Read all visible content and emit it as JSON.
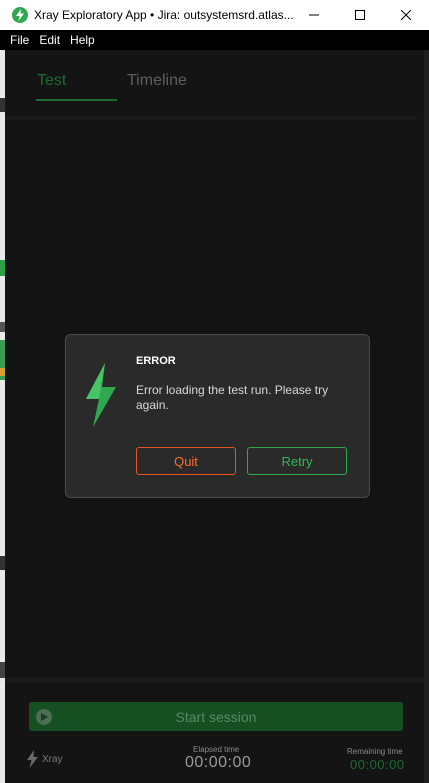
{
  "window": {
    "title": "Xray Exploratory App • Jira: outsystemsrd.atlas...",
    "icons": [
      "xray-app-icon",
      "minimize-icon",
      "maximize-icon",
      "close-icon"
    ]
  },
  "menu": {
    "items": [
      {
        "label": "File"
      },
      {
        "label": "Edit"
      },
      {
        "label": "Help"
      }
    ]
  },
  "tabs": [
    {
      "label": "Test",
      "active": true
    },
    {
      "label": "Timeline",
      "active": false
    }
  ],
  "dialog": {
    "title": "ERROR",
    "message": "Error loading the test run. Please try again.",
    "quit_label": "Quit",
    "retry_label": "Retry",
    "icon": "lightning-bolt-icon"
  },
  "session": {
    "start_label": "Start session",
    "brand": "Xray",
    "elapsed_label": "Elapsed time",
    "elapsed_value": "00:00:00",
    "remaining_label": "Remaining time",
    "remaining_value": "00:00:00"
  },
  "colors": {
    "accent_green": "#2fa84f",
    "quit_orange": "#ff6b2d",
    "background": "#141414",
    "dialog_bg": "#2a2a2a"
  }
}
